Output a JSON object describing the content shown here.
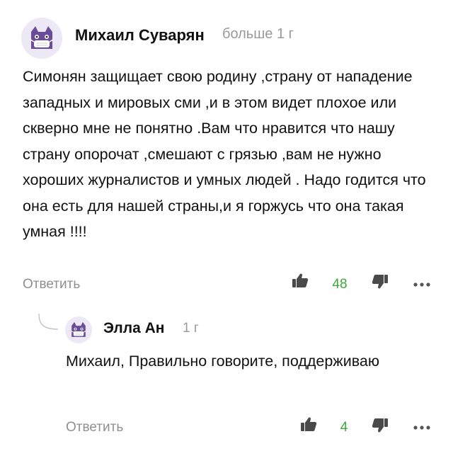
{
  "comment": {
    "author": "Михаил Суварян",
    "time": "больше 1 г",
    "avatar_icon": "cat-mask-avatar-icon",
    "text": "Симонян защищает свою родину ,страну от нападение западных и мировых сми ,и в этом видет плохое или скверно мне не понятно .Вам что нравится что нашу страну опорочат ,смешают с грязью ,вам не нужно хороших журналистов и умных людей . Надо годится что она есть для нашей страны,и я горжусь что она такая умная !!!!",
    "reply_label": "Ответить",
    "like_icon": "thumbs-up-icon",
    "likes": "48",
    "dislike_icon": "thumbs-down-icon",
    "more_icon": "more-dots-icon"
  },
  "reply": {
    "author": "Элла Ан",
    "time": "1 г",
    "avatar_icon": "cat-mask-avatar-icon",
    "text": "Михаил, Правильно говорите, поддерживаю",
    "reply_label": "Ответить",
    "like_icon": "thumbs-up-icon",
    "likes": "4",
    "dislike_icon": "thumbs-down-icon",
    "more_icon": "more-dots-icon"
  },
  "colors": {
    "text": "#111111",
    "muted": "#9a9a9a",
    "likes": "#3aa83a",
    "icon": "#4a4a4a",
    "avatar_bg": "#ece8f5",
    "avatar_cat": "#6b4c9a"
  }
}
